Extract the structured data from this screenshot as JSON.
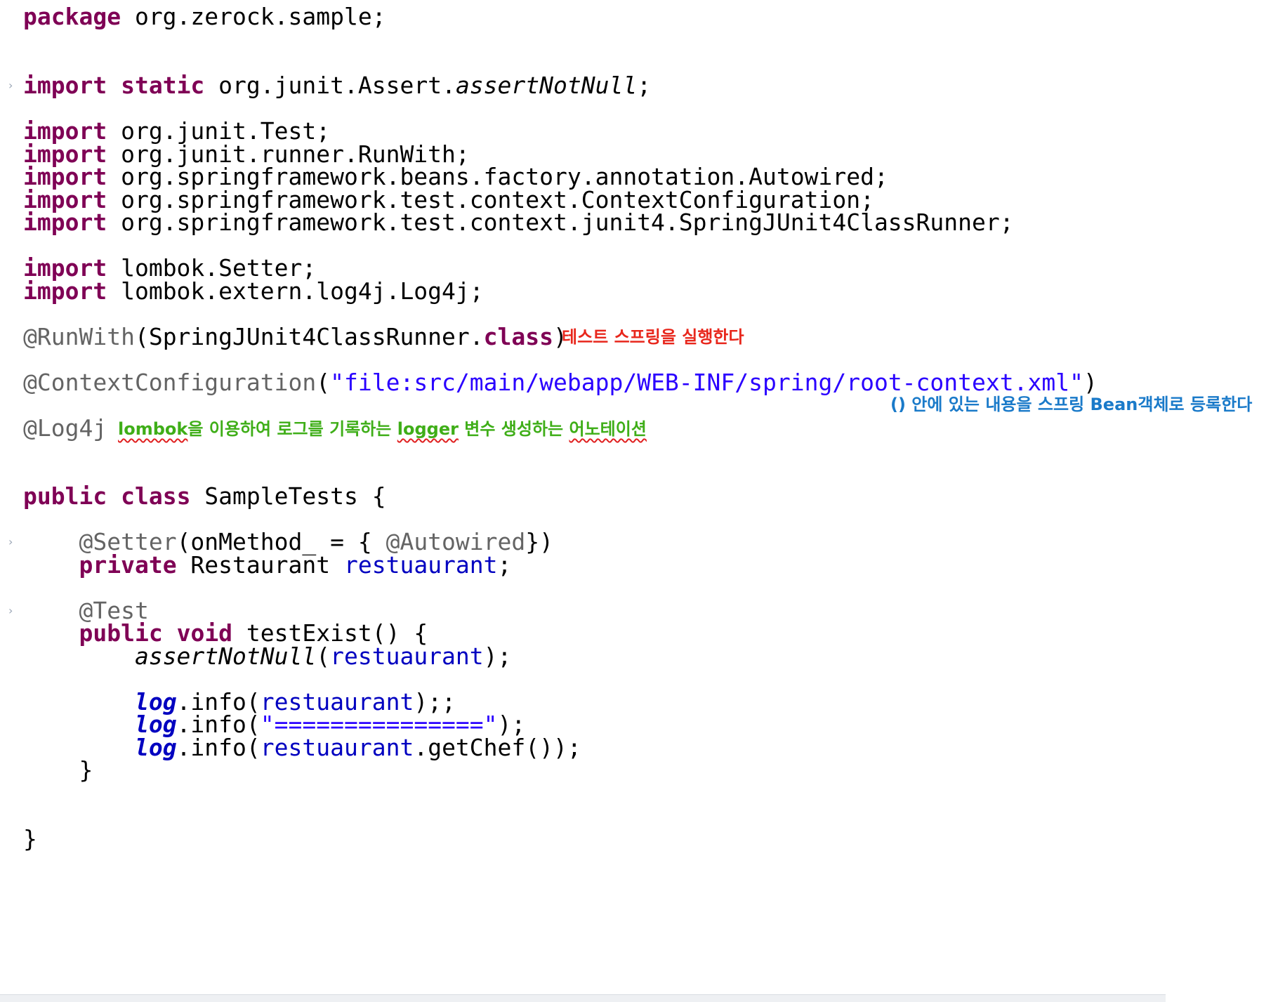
{
  "code": {
    "package_kw": "package",
    "package_name": " org.zerock.sample;",
    "import_kw": "import",
    "static_kw": "static",
    "static_import_path": " org.junit.Assert.",
    "static_import_method": "assertNotNull",
    "semicolon": ";",
    "imports": [
      " org.junit.Test;",
      " org.junit.runner.RunWith;",
      " org.springframework.beans.factory.annotation.Autowired;",
      " org.springframework.test.context.ContextConfiguration;",
      " org.springframework.test.context.junit4.SpringJUnit4ClassRunner;",
      " lombok.Setter;",
      " lombok.extern.log4j.Log4j;"
    ],
    "runwith_ann": "@RunWith",
    "runwith_arg": "(SpringJUnit4ClassRunner.",
    "class_kw": "class",
    "close_paren": ")",
    "context_ann": "@ContextConfiguration",
    "open_paren": "(",
    "context_str": "\"file:src/main/webapp/WEB-INF/spring/root-context.xml\"",
    "log4j_ann": "@Log4j",
    "public_kw": "public",
    "class_name": " SampleTests {",
    "setter_ann": "@Setter",
    "setter_open": "(onMethod_ = { ",
    "autowired_ann": "@Autowired",
    "setter_close": "})",
    "private_kw": "private",
    "field_type": " Restaurant ",
    "field_name": "restuaurant",
    "test_ann": "@Test",
    "void_kw": "void",
    "method_sig": " testExist() {",
    "assert_call": "assertNotNull",
    "assert_end": ");",
    "log_kw": "log",
    "info_open": ".info(",
    "info1_end": ");;",
    "info2_str": "\"===============\"",
    "info2_end": ");",
    "getchef": ".getChef());",
    "close_brace": "}"
  },
  "notes": {
    "runwith": "테스트 스프링을 실행한다",
    "context": "() 안에 있는 내용을 스프링 Bean객체로 등록한다",
    "log4j_lombok": "lombok",
    "log4j_part1": "을 이용하여 로그를 기록하는 ",
    "log4j_logger": "logger",
    "log4j_part2": " 변수 생성하는 ",
    "log4j_annotation": "어노테이션"
  },
  "colors": {
    "keyword": "#7f0055",
    "annotation": "#646464",
    "string": "#2a00ff",
    "field": "#0000c0",
    "note_red": "#e8271c",
    "note_blue": "#1a7ac9",
    "note_green": "#3fae18"
  }
}
